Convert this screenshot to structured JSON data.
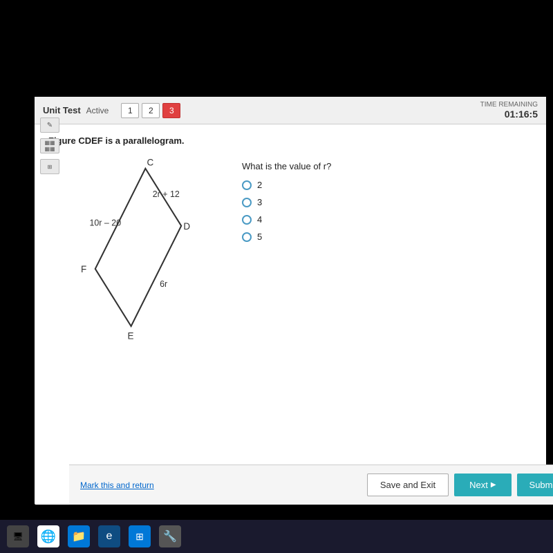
{
  "header": {
    "unit_test_label": "Unit Test",
    "active_label": "Active",
    "tabs": [
      {
        "number": "1",
        "active": false
      },
      {
        "number": "2",
        "active": false
      },
      {
        "number": "3",
        "active": true
      }
    ],
    "time_remaining_label": "TIME REMAINING",
    "time_value": "01:16:5"
  },
  "question": {
    "statement": "Figure CDEF is a parallelogram.",
    "answer_prompt": "What is the value of r?",
    "labels": {
      "c": "C",
      "d": "D",
      "e": "E",
      "f": "F",
      "top_side": "2r + 12",
      "left_side": "10r – 20",
      "bottom_side": "6r"
    },
    "options": [
      {
        "value": "2",
        "label": "2"
      },
      {
        "value": "3",
        "label": "3"
      },
      {
        "value": "4",
        "label": "4"
      },
      {
        "value": "5",
        "label": "5"
      }
    ]
  },
  "bottom_bar": {
    "mark_return_label": "Mark this and return",
    "save_exit_label": "Save and Exit",
    "next_label": "Next",
    "submit_label": "Submit"
  },
  "sidebar": {
    "pencil_icon": "✎",
    "calc_icon": "▦",
    "grid_icon": "⊞"
  }
}
